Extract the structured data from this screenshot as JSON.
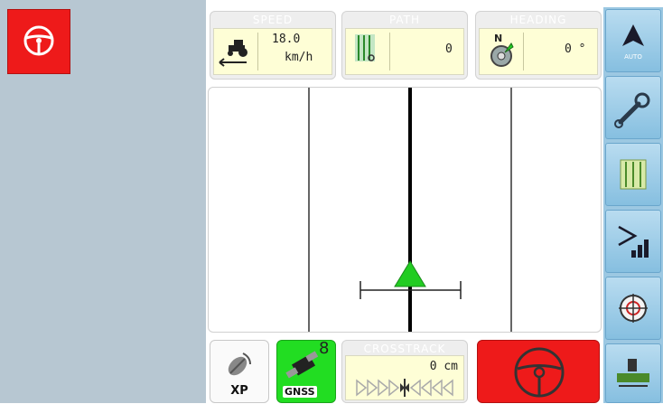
{
  "speed": {
    "label": "SPEED",
    "value": "18.0",
    "unit": "km/h"
  },
  "path": {
    "label": "PATH",
    "value": "0"
  },
  "heading": {
    "label": "HEADING",
    "value": "0 °",
    "north_label": "N"
  },
  "crosstrack": {
    "label": "CROSSTRACK",
    "value": "0 cm"
  },
  "xp": {
    "label": "XP"
  },
  "gnss": {
    "label": "GNSS",
    "satellites": "8"
  },
  "icons": {
    "steer_small": "steering-wheel-icon",
    "auto": "auto-steer-icon",
    "auto_label": "AUTO",
    "settings": "wrench-icon",
    "field": "field-map-icon",
    "signal": "signal-strength-icon",
    "target": "target-icon",
    "implement": "implement-icon"
  },
  "colors": {
    "engage_red": "#ee1a1a",
    "gnss_green": "#22dd22",
    "side_blue": "#9cc8e2",
    "vehicle_green": "#22cc22"
  }
}
